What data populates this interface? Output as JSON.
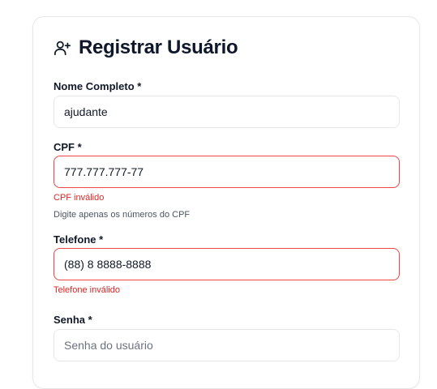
{
  "form": {
    "title": "Registrar Usuário",
    "icon": "user-plus-icon",
    "fields": {
      "nome": {
        "label": "Nome Completo *",
        "value": "ajudante"
      },
      "cpf": {
        "label": "CPF *",
        "value": "777.777.777-77",
        "error": "CPF inválido",
        "hint": "Digite apenas os números do CPF"
      },
      "telefone": {
        "label": "Telefone *",
        "value": "(88) 8 8888-8888",
        "error": "Telefone inválido"
      },
      "senha": {
        "label": "Senha *",
        "placeholder": "Senha do usuário"
      }
    }
  },
  "colors": {
    "error": "#ef4444",
    "border": "#e5e7eb",
    "text": "#111827"
  }
}
